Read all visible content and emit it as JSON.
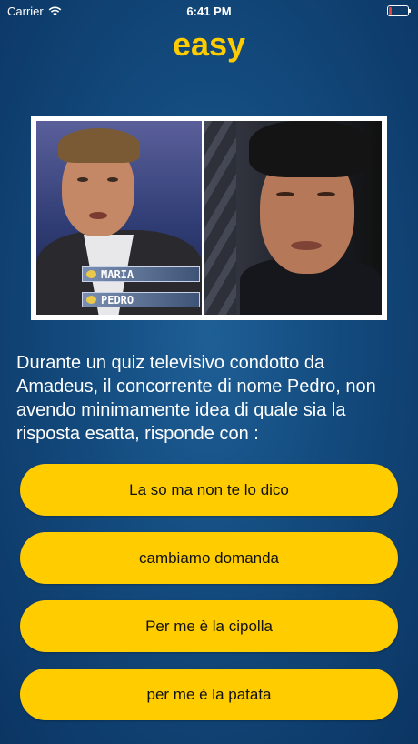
{
  "status_bar": {
    "carrier": "Carrier",
    "time": "6:41 PM"
  },
  "title": "easy",
  "image": {
    "left_tags": [
      "MARIA",
      "PEDRO"
    ]
  },
  "question": "Durante un quiz televisivo condotto da Amadeus, il concorrente di nome Pedro, non avendo minimamente idea di quale sia la risposta esatta, risponde con :",
  "answers": [
    "La so ma non te lo dico",
    "cambiamo domanda",
    "Per me è la cipolla",
    "per me è la patata"
  ],
  "colors": {
    "accent": "#ffcc00",
    "background": "#134a7d"
  }
}
